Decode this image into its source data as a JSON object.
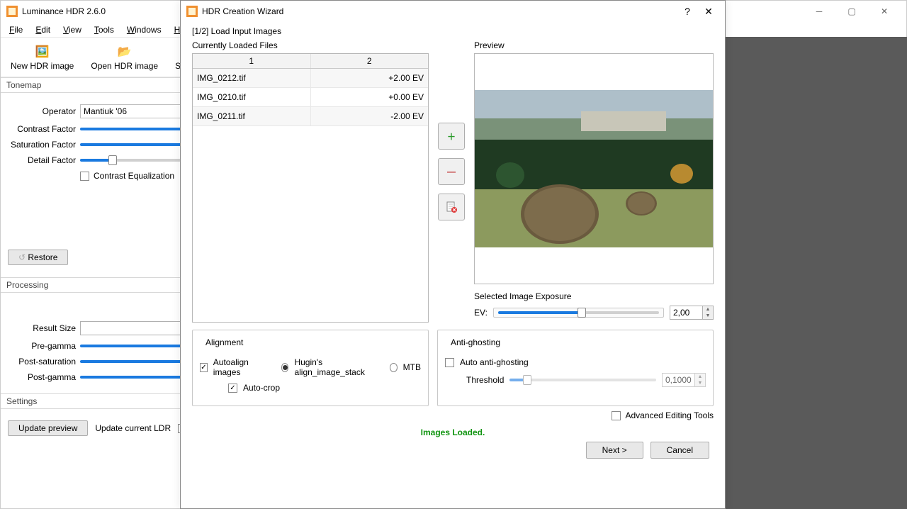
{
  "app": {
    "title": "Luminance HDR 2.6.0"
  },
  "menu": {
    "file": "File",
    "edit": "Edit",
    "view": "View",
    "tools": "Tools",
    "windows": "Windows",
    "help": "Help"
  },
  "toolbar": {
    "new": "New HDR image",
    "open": "Open HDR image",
    "saveas": "Save as..."
  },
  "tonemap": {
    "head": "Tonemap",
    "operator_label": "Operator",
    "operator_value": "Mantiuk '06",
    "contrast": "Contrast Factor",
    "saturation": "Saturation Factor",
    "detail": "Detail Factor",
    "contrast_eq": "Contrast Equalization",
    "restore": "Restore"
  },
  "processing": {
    "head": "Processing",
    "result_size": "Result Size",
    "pre_gamma": "Pre-gamma",
    "post_sat": "Post-saturation",
    "post_gamma": "Post-gamma"
  },
  "settings": {
    "head": "Settings",
    "update_preview": "Update preview",
    "update_ldr": "Update current LDR"
  },
  "dialog": {
    "title": "HDR Creation Wizard",
    "step": "[1/2] Load Input Images",
    "loaded_label": "Currently Loaded Files",
    "col1": "1",
    "col2": "2",
    "files": [
      {
        "name": "IMG_0212.tif",
        "ev": "+2.00 EV"
      },
      {
        "name": "IMG_0210.tif",
        "ev": "+0.00 EV"
      },
      {
        "name": "IMG_0211.tif",
        "ev": "-2.00 EV"
      }
    ],
    "preview": "Preview",
    "sel_exposure": "Selected Image Exposure",
    "ev_label": "EV:",
    "ev_value": "2,00",
    "alignment": "Alignment",
    "autoalign": "Autoalign images",
    "hugin": "Hugin's align_image_stack",
    "mtb": "MTB",
    "autocrop": "Auto-crop",
    "antighost": "Anti-ghosting",
    "auto_antighost": "Auto anti-ghosting",
    "threshold": "Threshold",
    "threshold_value": "0,1000",
    "advanced": "Advanced Editing Tools",
    "status": "Images Loaded.",
    "next": "Next >",
    "cancel": "Cancel"
  }
}
